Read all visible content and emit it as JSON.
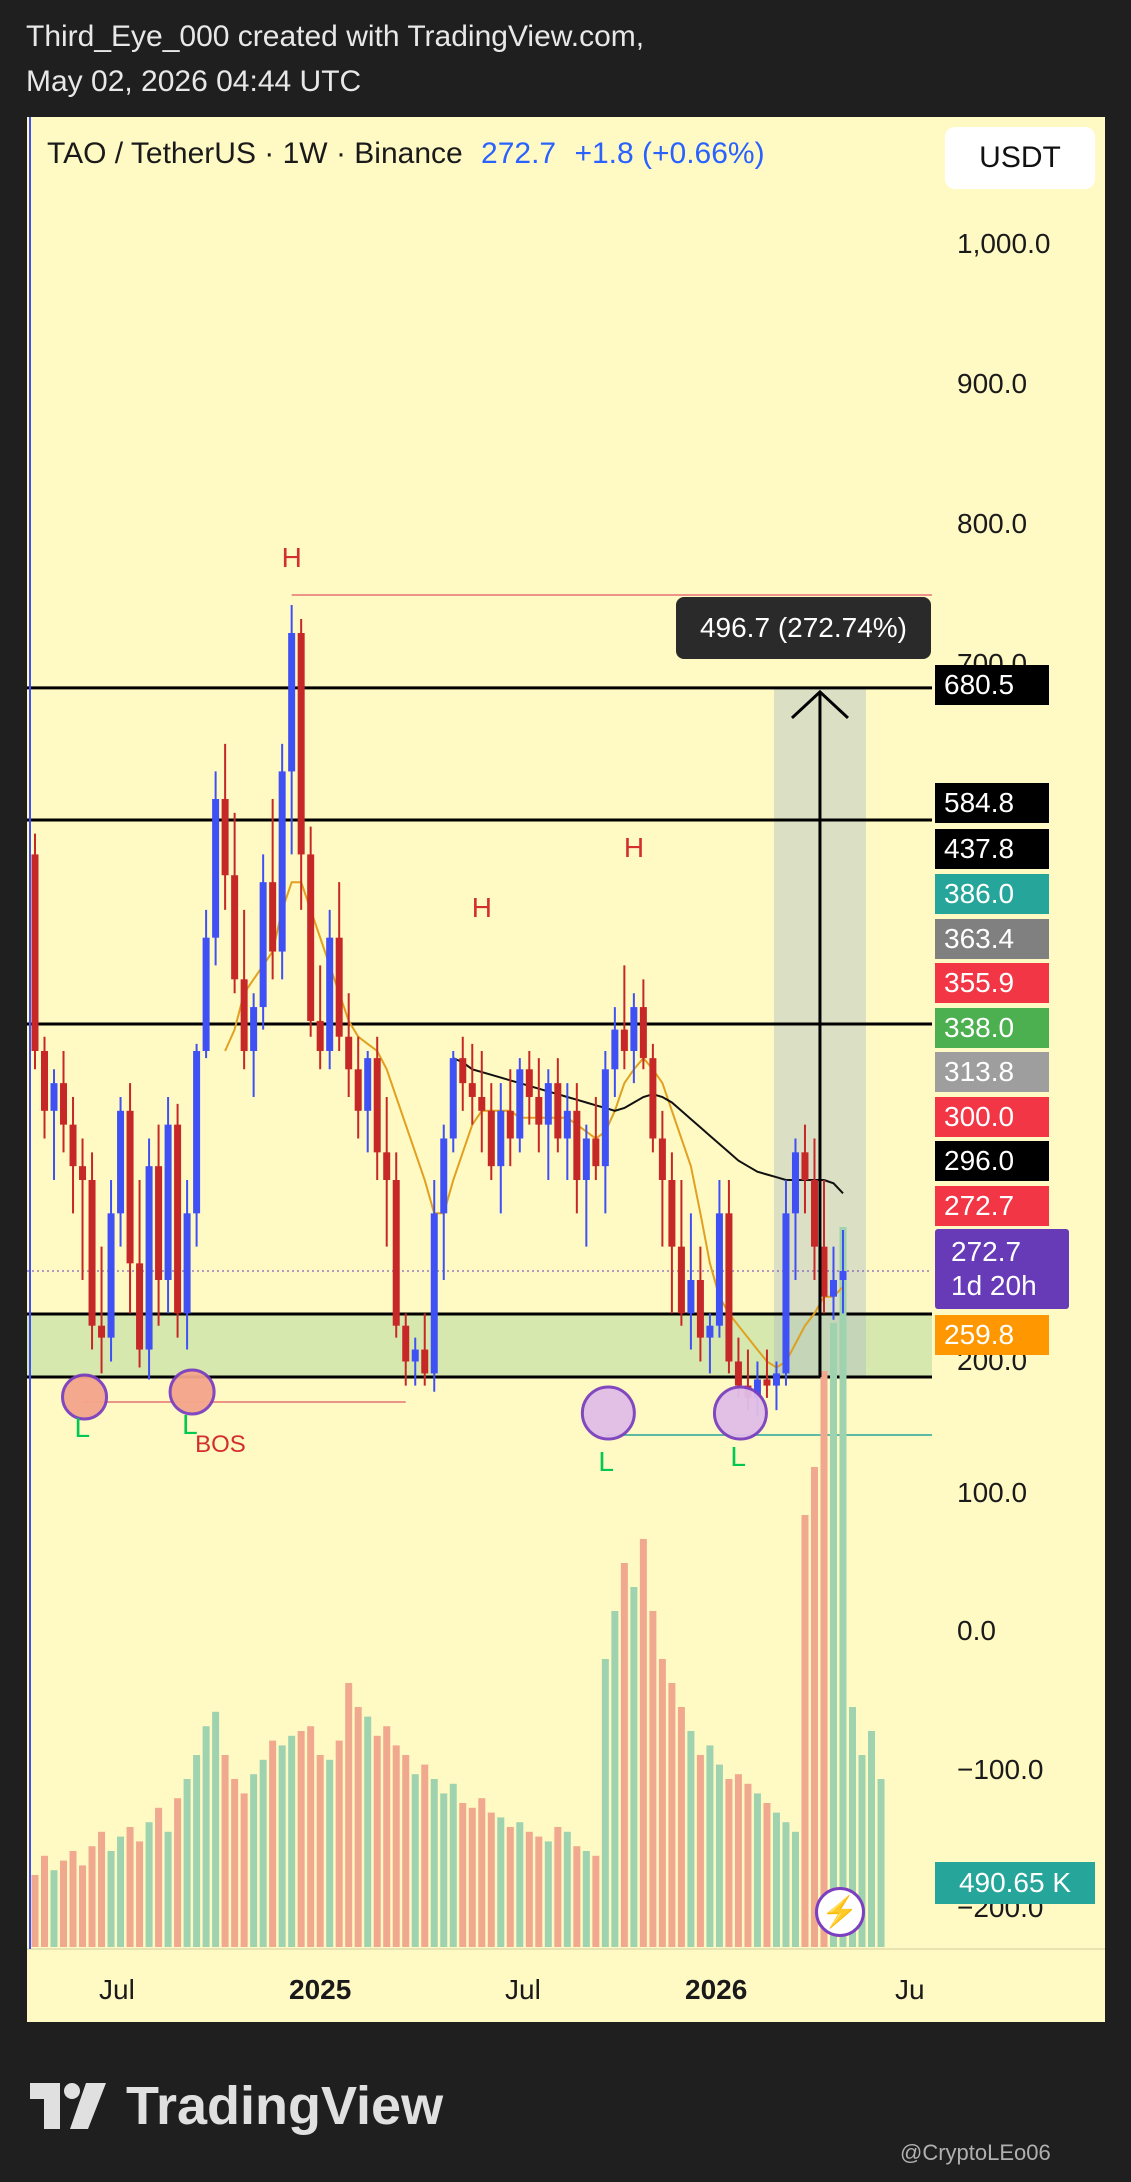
{
  "header": {
    "author_line": "Third_Eye_000 created with TradingView.com,",
    "date_line": "May 02, 2026 04:44 UTC"
  },
  "symbol": {
    "title": "TAO / TetherUS · 1W · Binance",
    "price": "272.7",
    "change": "+1.8 (+0.66%)"
  },
  "currency_button": "USDT",
  "measure_label": "496.7 (272.74%)",
  "price_tags": [
    {
      "text": "680.5",
      "color": "#000000"
    },
    {
      "text": "584.8",
      "color": "#000000"
    },
    {
      "text": "437.8",
      "color": "#000000"
    },
    {
      "text": "386.0",
      "color": "#26a69a"
    },
    {
      "text": "363.4",
      "color": "#808080"
    },
    {
      "text": "355.9",
      "color": "#f23645"
    },
    {
      "text": "338.0",
      "color": "#4caf50"
    },
    {
      "text": "313.8",
      "color": "#9e9e9e"
    },
    {
      "text": "300.0",
      "color": "#f23645"
    },
    {
      "text": "296.0",
      "color": "#000000"
    },
    {
      "text": "272.7",
      "color": "#f23645"
    },
    {
      "text": "259.8",
      "color": "#ff9800"
    }
  ],
  "current_price_tag": {
    "price": "272.7",
    "countdown": "1d 20h",
    "color": "#673ab7"
  },
  "volume_badge": "490.65 K",
  "flash_icon": "lightning-bolt-icon",
  "brand": "TradingView",
  "watermark": "@CryptoLEo06",
  "chart_data": {
    "type": "candlestick",
    "timeframe": "1W",
    "x_tick_labels": [
      "Jul",
      "2025",
      "Jul",
      "2026",
      "Ju"
    ],
    "y_tick_labels": [
      "1,000.0",
      "900.0",
      "800.0",
      "700.0",
      "200.0",
      "100.0",
      "0.0",
      "−100.0",
      "−200.0"
    ],
    "horizontal_levels": [
      680.5,
      584.8,
      437.8,
      259.8,
      207
    ],
    "support_zone": [
      207,
      259.8
    ],
    "measure": {
      "from": 207,
      "to": 680.5,
      "label": "496.7 (272.74%)"
    },
    "annotations": [
      {
        "text": "H",
        "color": "#d32f2f",
        "at": "2024 Dec high"
      },
      {
        "text": "H",
        "color": "#d32f2f",
        "at": "2025 May"
      },
      {
        "text": "H",
        "color": "#d32f2f",
        "at": "2025 Oct"
      },
      {
        "text": "L",
        "color": "#00c853",
        "at": "2024 Aug"
      },
      {
        "text": "L",
        "color": "#00c853",
        "at": "2025 Apr"
      },
      {
        "text": "L",
        "color": "#00c853",
        "at": "2025 Oct"
      },
      {
        "text": "L",
        "color": "#00c853",
        "at": "2026 Feb"
      },
      {
        "text": "BOS",
        "color": "#d32f2f",
        "at": "2025 Apr"
      }
    ],
    "candles_ohlc": [
      [
        560,
        575,
        380,
        400
      ],
      [
        400,
        420,
        330,
        350
      ],
      [
        350,
        380,
        300,
        370
      ],
      [
        370,
        400,
        320,
        340
      ],
      [
        340,
        360,
        290,
        310
      ],
      [
        310,
        330,
        270,
        300
      ],
      [
        300,
        320,
        230,
        250
      ],
      [
        250,
        280,
        210,
        240
      ],
      [
        240,
        300,
        220,
        290
      ],
      [
        290,
        360,
        280,
        350
      ],
      [
        350,
        370,
        260,
        275
      ],
      [
        275,
        300,
        215,
        230
      ],
      [
        230,
        330,
        205,
        310
      ],
      [
        310,
        340,
        250,
        270
      ],
      [
        270,
        360,
        260,
        340
      ],
      [
        340,
        355,
        240,
        260
      ],
      [
        260,
        300,
        230,
        290
      ],
      [
        290,
        410,
        280,
        400
      ],
      [
        400,
        520,
        390,
        500
      ],
      [
        500,
        620,
        480,
        600
      ],
      [
        600,
        640,
        520,
        545
      ],
      [
        545,
        590,
        460,
        470
      ],
      [
        470,
        520,
        380,
        400
      ],
      [
        400,
        460,
        360,
        450
      ],
      [
        450,
        560,
        430,
        540
      ],
      [
        540,
        600,
        470,
        490
      ],
      [
        490,
        640,
        470,
        620
      ],
      [
        620,
        740,
        560,
        720
      ],
      [
        720,
        730,
        520,
        560
      ],
      [
        560,
        580,
        420,
        440
      ],
      [
        440,
        480,
        380,
        400
      ],
      [
        400,
        520,
        380,
        500
      ],
      [
        500,
        540,
        400,
        420
      ],
      [
        420,
        460,
        360,
        380
      ],
      [
        380,
        420,
        330,
        350
      ],
      [
        350,
        400,
        320,
        390
      ],
      [
        390,
        420,
        300,
        320
      ],
      [
        320,
        360,
        280,
        300
      ],
      [
        300,
        320,
        240,
        250
      ],
      [
        250,
        260,
        200,
        220
      ],
      [
        220,
        240,
        200,
        230
      ],
      [
        230,
        260,
        200,
        210
      ],
      [
        210,
        300,
        195,
        290
      ],
      [
        290,
        340,
        270,
        330
      ],
      [
        330,
        400,
        320,
        390
      ],
      [
        390,
        420,
        350,
        370
      ],
      [
        370,
        410,
        340,
        360
      ],
      [
        360,
        400,
        320,
        350
      ],
      [
        350,
        370,
        300,
        310
      ],
      [
        310,
        370,
        290,
        350
      ],
      [
        350,
        380,
        310,
        330
      ],
      [
        330,
        390,
        320,
        380
      ],
      [
        380,
        400,
        340,
        360
      ],
      [
        360,
        390,
        320,
        340
      ],
      [
        340,
        380,
        300,
        370
      ],
      [
        370,
        390,
        320,
        330
      ],
      [
        330,
        370,
        300,
        350
      ],
      [
        350,
        370,
        290,
        300
      ],
      [
        300,
        340,
        280,
        330
      ],
      [
        330,
        360,
        300,
        310
      ],
      [
        310,
        400,
        290,
        380
      ],
      [
        380,
        450,
        360,
        430
      ],
      [
        430,
        480,
        380,
        400
      ],
      [
        400,
        460,
        370,
        450
      ],
      [
        450,
        470,
        380,
        390
      ],
      [
        390,
        410,
        320,
        330
      ],
      [
        330,
        350,
        280,
        300
      ],
      [
        300,
        320,
        260,
        280
      ],
      [
        280,
        300,
        250,
        260
      ],
      [
        260,
        290,
        230,
        270
      ],
      [
        270,
        280,
        220,
        240
      ],
      [
        240,
        260,
        210,
        250
      ],
      [
        250,
        300,
        240,
        290
      ],
      [
        290,
        300,
        210,
        220
      ],
      [
        220,
        240,
        190,
        200
      ],
      [
        200,
        230,
        180,
        190
      ],
      [
        190,
        220,
        175,
        205
      ],
      [
        205,
        230,
        190,
        200
      ],
      [
        200,
        220,
        180,
        210
      ],
      [
        210,
        300,
        200,
        290
      ],
      [
        290,
        330,
        270,
        320
      ],
      [
        320,
        340,
        290,
        300
      ],
      [
        300,
        330,
        270,
        280
      ],
      [
        280,
        300,
        260,
        265
      ],
      [
        265,
        280,
        255,
        270
      ],
      [
        270,
        285,
        260,
        272.7
      ]
    ],
    "moving_averages": [
      {
        "name": "",
        "color": "#e0a020",
        "approx_values": [
          null,
          null,
          null,
          null,
          null,
          null,
          null,
          null,
          null,
          null,
          null,
          null,
          null,
          null,
          null,
          null,
          null,
          null,
          null,
          null,
          400,
          430,
          460,
          470,
          480,
          490,
          520,
          540,
          540,
          520,
          500,
          480,
          460,
          440,
          420,
          410,
          400,
          380,
          360,
          340,
          320,
          300,
          290,
          290,
          300,
          320,
          340,
          350,
          350,
          350,
          350,
          345,
          345,
          345,
          345,
          345,
          345,
          340,
          335,
          330,
          335,
          350,
          370,
          380,
          390,
          380,
          370,
          350,
          330,
          310,
          290,
          275,
          265,
          260,
          250,
          240,
          230,
          220,
          215,
          220,
          235,
          250,
          260,
          265,
          265,
          268
        ]
      },
      {
        "name": "",
        "color": "#111111",
        "approx_values": [
          null,
          null,
          null,
          null,
          null,
          null,
          null,
          null,
          null,
          null,
          null,
          null,
          null,
          null,
          null,
          null,
          null,
          null,
          null,
          null,
          null,
          null,
          null,
          null,
          null,
          null,
          null,
          null,
          null,
          null,
          null,
          null,
          null,
          null,
          null,
          null,
          null,
          null,
          null,
          null,
          null,
          null,
          null,
          null,
          390,
          385,
          380,
          378,
          376,
          374,
          372,
          370,
          368,
          366,
          364,
          362,
          360,
          358,
          356,
          354,
          352,
          350,
          352,
          356,
          360,
          362,
          360,
          356,
          350,
          344,
          338,
          332,
          326,
          320,
          314,
          310,
          306,
          304,
          302,
          300,
          300,
          300,
          300,
          300,
          299,
          296
        ]
      }
    ],
    "volume": [
      30,
      38,
      32,
      36,
      40,
      34,
      42,
      48,
      40,
      46,
      50,
      44,
      52,
      58,
      48,
      62,
      70,
      80,
      92,
      98,
      80,
      70,
      64,
      72,
      78,
      86,
      84,
      88,
      90,
      92,
      80,
      78,
      86,
      110,
      100,
      96,
      88,
      92,
      84,
      80,
      72,
      76,
      70,
      64,
      68,
      60,
      58,
      62,
      56,
      54,
      50,
      52,
      48,
      46,
      44,
      50,
      48,
      42,
      40,
      38,
      120,
      140,
      160,
      150,
      170,
      140,
      120,
      110,
      100,
      90,
      80,
      84,
      76,
      70,
      72,
      68,
      64,
      60,
      56,
      52,
      48,
      180,
      200,
      240,
      260,
      300,
      100,
      80,
      90,
      70
    ],
    "volume_axis_labels": [
      "100.0",
      "0.0",
      "−100.0",
      "−200.0"
    ]
  }
}
